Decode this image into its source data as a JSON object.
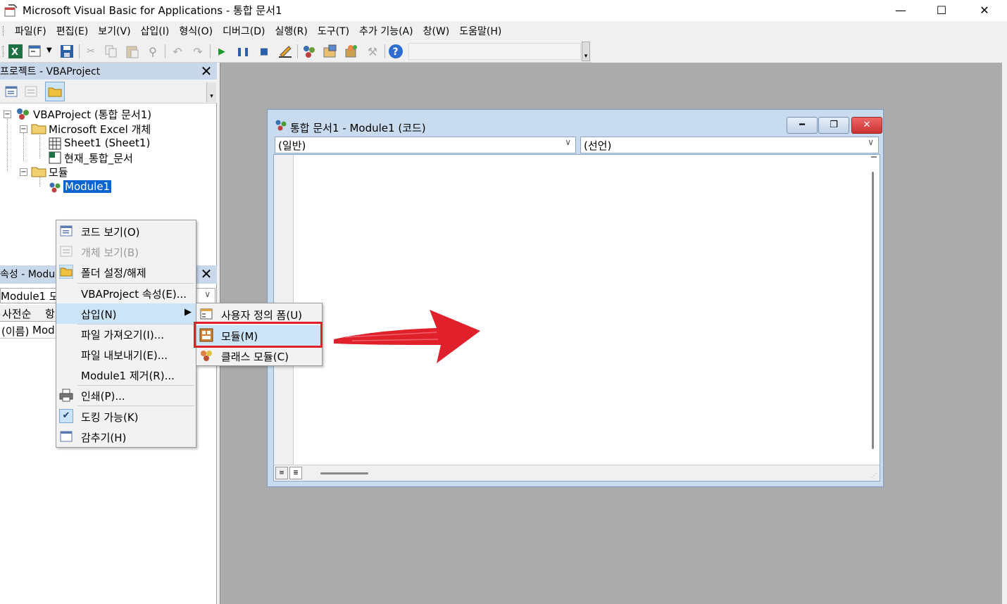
{
  "window": {
    "title": "Microsoft Visual Basic for Applications - 통합 문서1",
    "minimize": "—",
    "maximize": "☐",
    "close": "✕"
  },
  "menubar": {
    "items": [
      "파일(F)",
      "편집(E)",
      "보기(V)",
      "삽입(I)",
      "형식(O)",
      "디버그(D)",
      "실행(R)",
      "도구(T)",
      "추가 기능(A)",
      "창(W)",
      "도움말(H)"
    ]
  },
  "project_pane": {
    "title": "프로젝트 - VBAProject",
    "close": "✕",
    "tree": {
      "root": "VBAProject (통합 문서1)",
      "excel_objects": "Microsoft Excel 개체",
      "sheet1": "Sheet1 (Sheet1)",
      "this_workbook": "현재_통합_문서",
      "modules_folder": "모듈",
      "module1": "Module1",
      "collapse": "−"
    }
  },
  "properties_pane": {
    "title": "속성 - Modu",
    "close": "✕",
    "object_combo": "Module1 모",
    "tabs": [
      "사전순",
      "항"
    ],
    "row_name": "(이름)",
    "row_value": "Mod"
  },
  "code_window": {
    "title": "통합 문서1 - Module1 (코드)",
    "object_combo": "(일반)",
    "proc_combo": "(선언)",
    "min": "━",
    "restore": "❐",
    "close": "✕"
  },
  "context_menu": {
    "items": [
      {
        "label": "코드 보기(O)",
        "disabled": false
      },
      {
        "label": "개체 보기(B)",
        "disabled": true
      },
      {
        "label": "폴더 설정/해제",
        "disabled": false
      },
      {
        "label": "VBAProject 속성(E)...",
        "disabled": false
      },
      {
        "label": "삽입(N)",
        "disabled": false
      },
      {
        "label": "파일 가져오기(I)...",
        "disabled": false
      },
      {
        "label": "파일 내보내기(E)...",
        "disabled": false
      },
      {
        "label": "Module1 제거(R)...",
        "disabled": false
      },
      {
        "label": "인쇄(P)...",
        "disabled": false
      },
      {
        "label": "도킹 가능(K)",
        "disabled": false
      },
      {
        "label": "감추기(H)",
        "disabled": false
      }
    ],
    "submenu_arrow": "▶",
    "check": "✔"
  },
  "submenu": {
    "items": [
      {
        "label": "사용자 정의 폼(U)"
      },
      {
        "label": "모듈(M)"
      },
      {
        "label": "클래스 모듈(C)"
      }
    ]
  },
  "colors": {
    "highlight": "#cce4f7",
    "annotation_red": "#e0202a"
  }
}
